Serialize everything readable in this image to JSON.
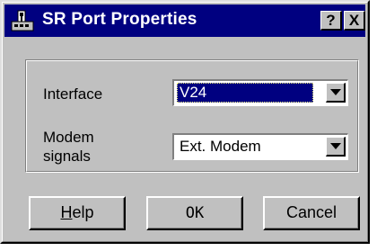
{
  "window": {
    "title": "SR Port  Properties",
    "icon": "network-port-icon",
    "caption_buttons": {
      "help": "?",
      "close": "X"
    }
  },
  "form": {
    "interface": {
      "label": "Interface",
      "value": "V24"
    },
    "modem_signals": {
      "label": "Modem signals",
      "value": "Ext. Modem"
    }
  },
  "buttons": {
    "help": {
      "mnemonic": "H",
      "rest": "elp"
    },
    "ok": "OK",
    "cancel": "Cancel"
  },
  "colors": {
    "titlebar": "#000080",
    "face": "#c0c0c0",
    "selection": "#000080"
  }
}
